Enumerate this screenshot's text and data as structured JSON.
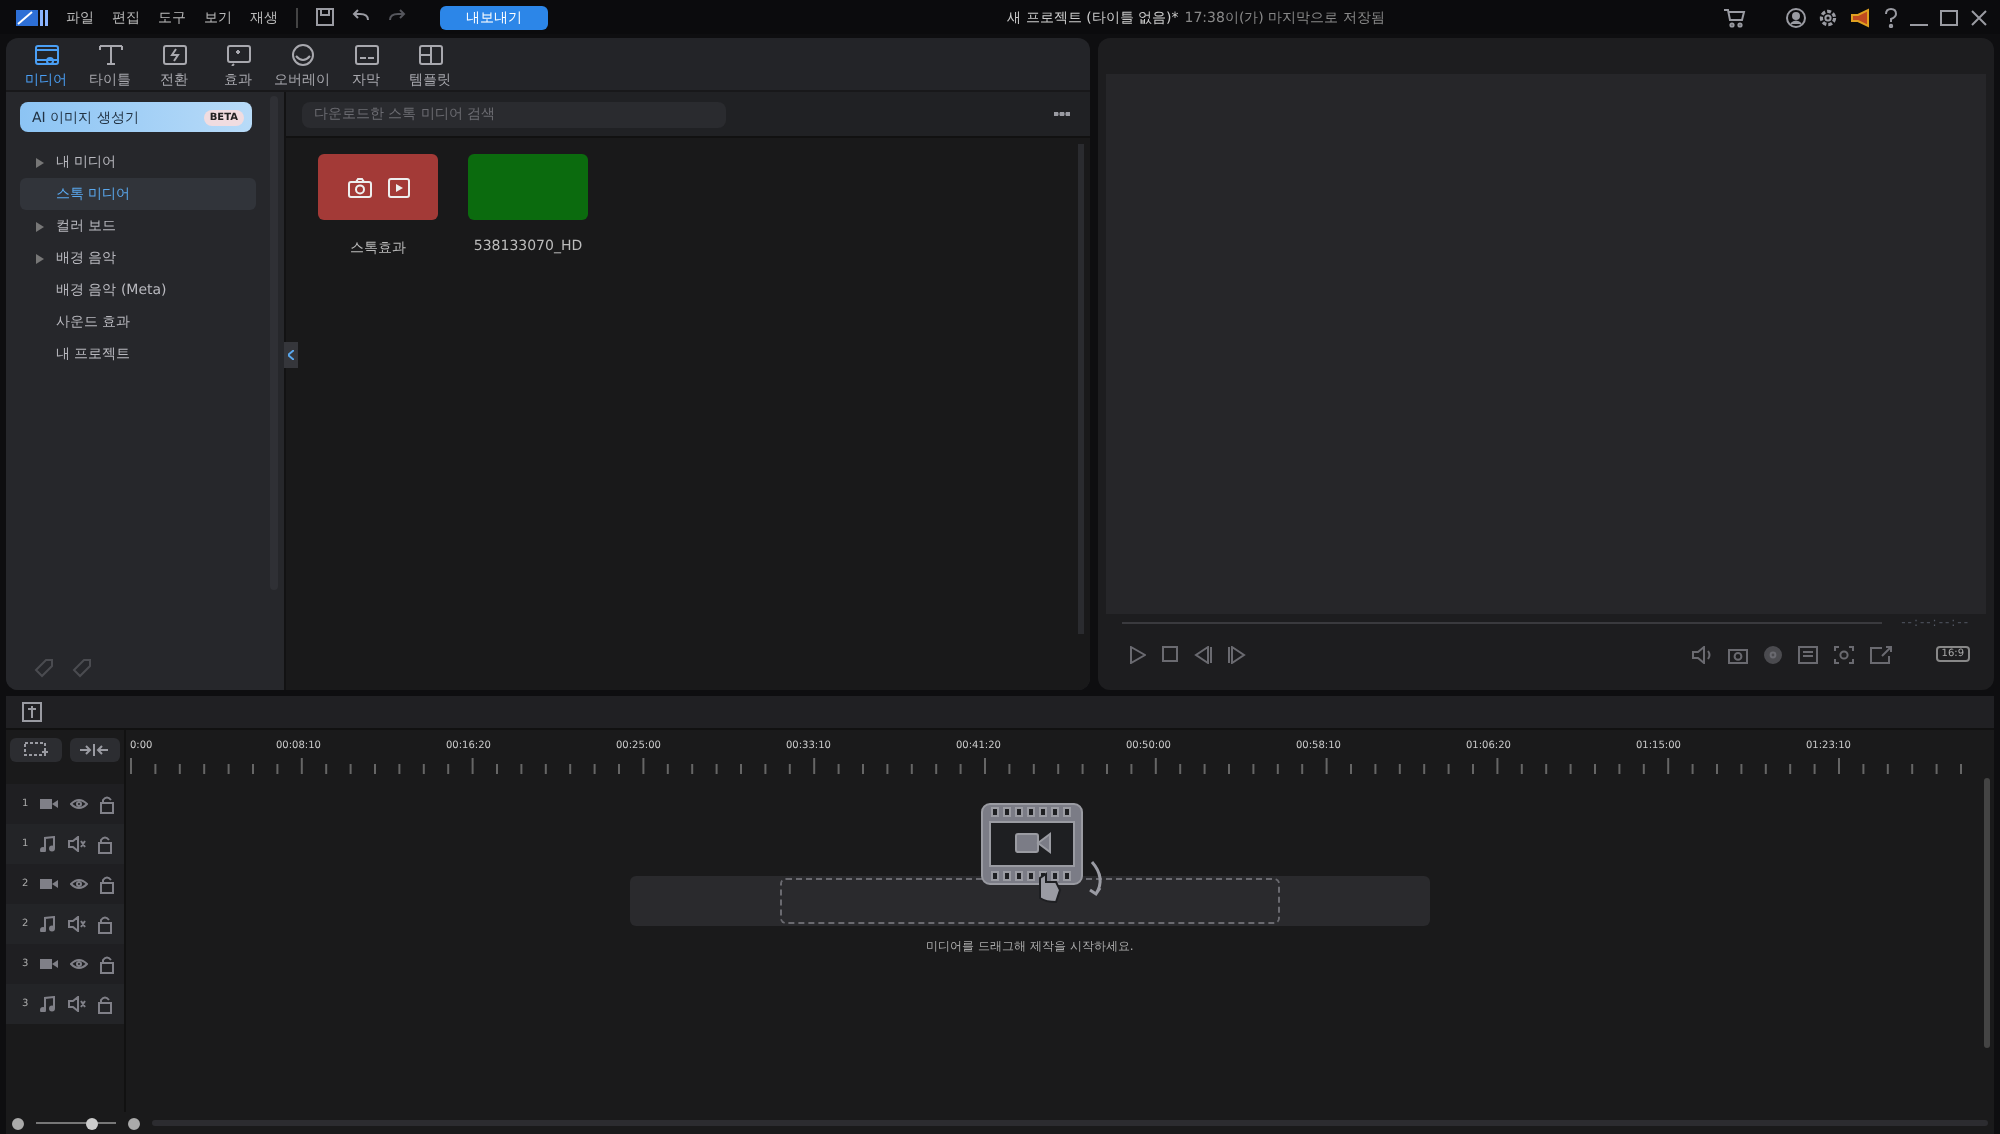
{
  "titlebar": {
    "menu": [
      "파일",
      "편집",
      "도구",
      "보기",
      "재생"
    ],
    "export_button": "내보내기",
    "title": "새 프로젝트 (타이틀 없음)*",
    "saved_note": "17:38이(가) 마지막으로 저장됨"
  },
  "tabs": [
    {
      "label": "미디어",
      "kind": "media",
      "selected": true
    },
    {
      "label": "타이틀",
      "kind": "title",
      "selected": false
    },
    {
      "label": "전환",
      "kind": "transition",
      "selected": false
    },
    {
      "label": "효과",
      "kind": "effect",
      "selected": false
    },
    {
      "label": "오버레이",
      "kind": "overlay",
      "selected": false
    },
    {
      "label": "자막",
      "kind": "subtitle",
      "selected": false
    },
    {
      "label": "템플릿",
      "kind": "template",
      "selected": false
    }
  ],
  "ai_button": {
    "label": "AI 이미지 생성기",
    "badge": "BETA"
  },
  "sidebar": {
    "items": [
      {
        "label": "내 미디어",
        "kind": "group",
        "selected": false
      },
      {
        "label": "스톡 미디어",
        "kind": "leaf",
        "selected": true
      },
      {
        "label": "컬러 보드",
        "kind": "group",
        "selected": false
      },
      {
        "label": "배경 음악",
        "kind": "group",
        "selected": false
      },
      {
        "label": "배경 음악 (Meta)",
        "kind": "leaf",
        "selected": false
      },
      {
        "label": "사운드 효과",
        "kind": "leaf",
        "selected": false
      },
      {
        "label": "내 프로젝트",
        "kind": "leaf",
        "selected": false
      }
    ]
  },
  "search": {
    "placeholder": "다운로드한 스톡 미디어 검색"
  },
  "media": [
    {
      "label": "스톡효과",
      "kind": "effects",
      "color": "#a33a37"
    },
    {
      "label": "538133070_HD",
      "kind": "clip",
      "color": "#0b6b0e"
    }
  ],
  "preview": {
    "timecode": "--:--:--:--",
    "aspect": "16:9"
  },
  "timeline": {
    "ruler": [
      "0:00",
      "00:08:10",
      "00:16:20",
      "00:25:00",
      "00:33:10",
      "00:41:20",
      "00:50:00",
      "00:58:10",
      "01:06:20",
      "01:15:00",
      "01:23:10"
    ],
    "tracks": [
      {
        "number": "1",
        "kind": "video"
      },
      {
        "number": "1",
        "kind": "audio"
      },
      {
        "number": "2",
        "kind": "video"
      },
      {
        "number": "2",
        "kind": "audio"
      },
      {
        "number": "3",
        "kind": "video"
      },
      {
        "number": "3",
        "kind": "audio"
      }
    ],
    "hint": "미디어를 드래그해 제작을 시작하세요.",
    "zoom": {
      "level": 0.7
    }
  }
}
